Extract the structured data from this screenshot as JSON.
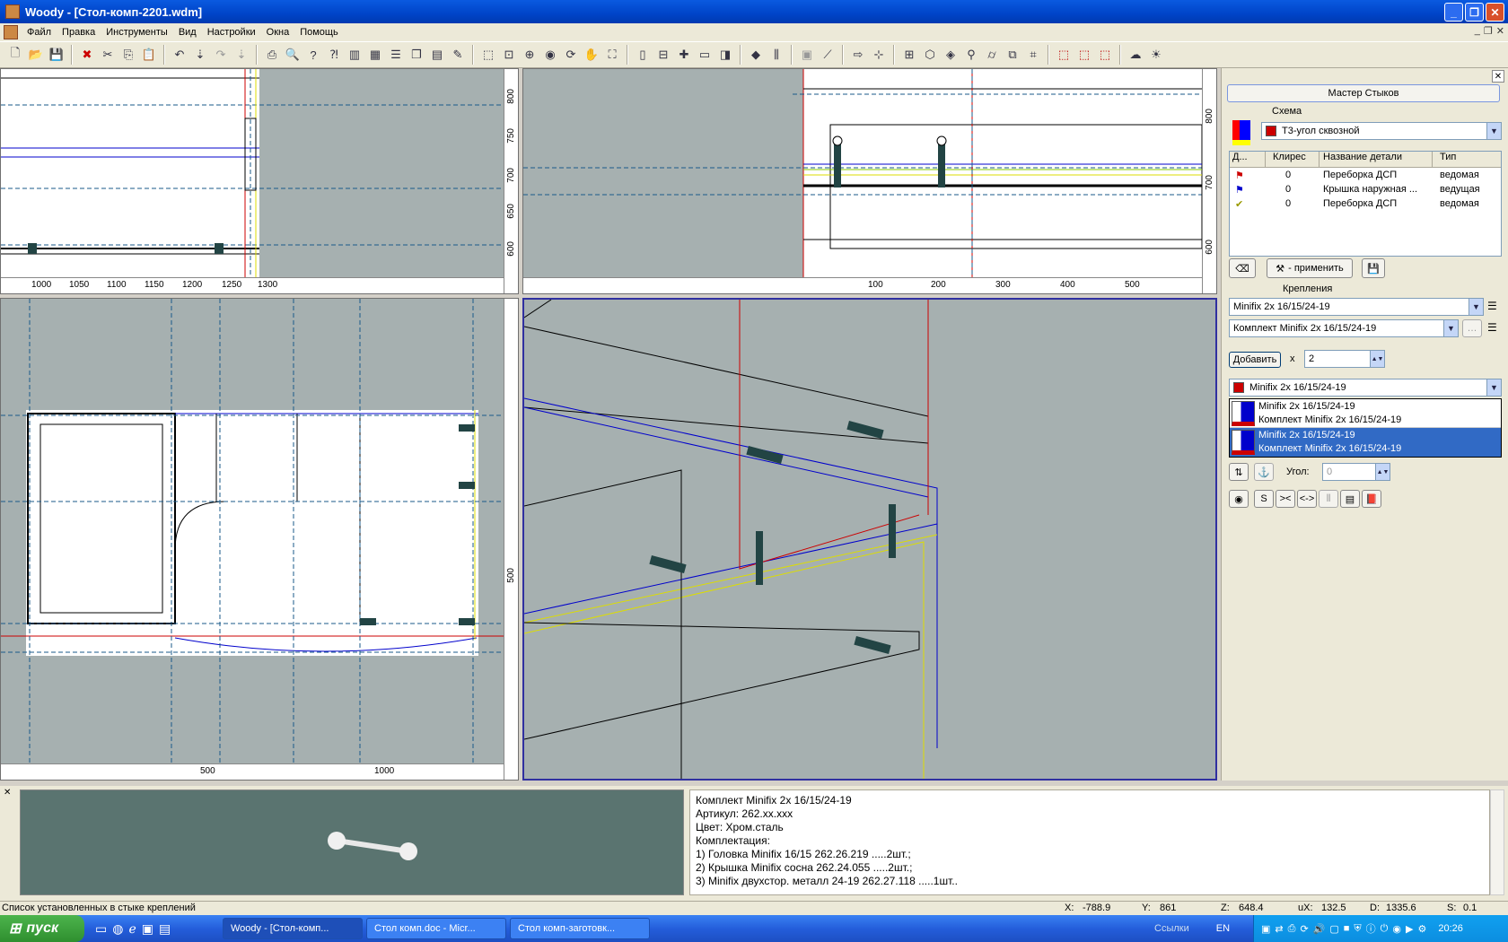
{
  "window": {
    "title": "Woody - [Стол-комп-2201.wdm]"
  },
  "menu": [
    "Файл",
    "Правка",
    "Инструменты",
    "Вид",
    "Настройки",
    "Окна",
    "Помощь"
  ],
  "rulers": {
    "tl_x": [
      "1000",
      "1050",
      "1100",
      "1150",
      "1200",
      "1250",
      "1300"
    ],
    "tl_y": [
      "800",
      "750",
      "700",
      "650",
      "600"
    ],
    "tr_x": [
      "100",
      "200",
      "300",
      "400",
      "500"
    ],
    "tr_y": [
      "800",
      "700",
      "600"
    ],
    "bl_x": [
      "500",
      "1000"
    ],
    "bl_y": [
      "500"
    ]
  },
  "panel": {
    "title": "Мастер Стыков",
    "scheme_label": "Схема",
    "scheme_value": "Т3-угол сквозной",
    "table": {
      "headers": [
        "Д...",
        "Клирес",
        "Название детали",
        "Тип"
      ],
      "rows": [
        {
          "klires": "0",
          "name": "Переборка ДСП",
          "type": "ведомая"
        },
        {
          "klires": "0",
          "name": "Крышка наружная ...",
          "type": "ведущая"
        },
        {
          "klires": "0",
          "name": "Переборка ДСП",
          "type": "ведомая"
        }
      ]
    },
    "apply_label": "- применить",
    "fastenings_label": "Крепления",
    "fastener_value": "Minifix 2x 16/15/24-19",
    "kit_value": "Комплект Minifix 2x 16/15/24-19",
    "add_label": "Добавить",
    "times_label": "x",
    "count_value": "2",
    "selected_value": "Minifix 2x 16/15/24-19",
    "list": [
      {
        "line1": "Minifix 2x 16/15/24-19",
        "line2": "Комплект Minifix 2x 16/15/24-19"
      },
      {
        "line1": "Minifix 2x 16/15/24-19",
        "line2": "Комплект Minifix 2x 16/15/24-19"
      }
    ],
    "angle_label": "Угол:",
    "angle_value": "0",
    "tool_labels": [
      "S",
      "><",
      "<->"
    ]
  },
  "info": {
    "lines": [
      "Комплект Minifix 2x 16/15/24-19",
      "Артикул: 262.xx.xxx",
      "Цвет: Хром.сталь",
      "Комплектация:",
      "1) Головка Minifix 16/15 262.26.219 .....2шт.;",
      "2) Крышка Minifix сосна 262.24.055 .....2шт.;",
      "3) Minifix двухстор. металл 24-19 262.27.118 .....1шт.."
    ]
  },
  "status": {
    "text": "Список установленных в стыке креплений",
    "x_label": "X:",
    "x": "-788.9",
    "y_label": "Y:",
    "y": "861",
    "z_label": "Z:",
    "z": "648.4",
    "ux_label": "uX:",
    "ux": "132.5",
    "d_label": "D:",
    "d": "1335.6",
    "s_label": "S:",
    "s": "0.1"
  },
  "taskbar": {
    "start": "пуск",
    "tasks": [
      "Woody - [Стол-комп...",
      "Стол комп.doc - Micr...",
      "Стол комп-заготовк..."
    ],
    "links": "Ссылки",
    "lang": "EN",
    "clock": "20:26"
  },
  "colors": {
    "viewport_bg": "#a6b0b0",
    "selection": "#316ac5",
    "preview_bg": "#5a7470"
  }
}
